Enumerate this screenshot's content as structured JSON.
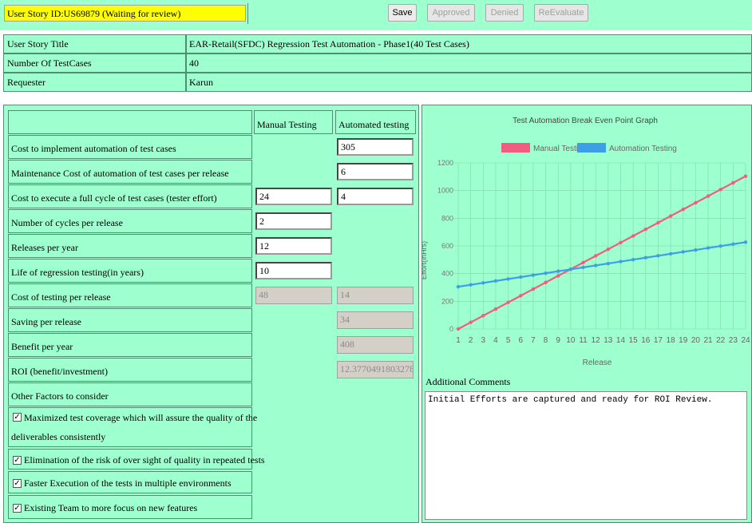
{
  "header": {
    "story_id": "User Story ID:US69879 (Waiting for review)",
    "buttons": {
      "save": "Save",
      "approved": "Approved",
      "denied": "Denied",
      "reevaluate": "ReEvaluate"
    }
  },
  "info": [
    {
      "label": "User Story Title",
      "value": "EAR-Retail(SFDC) Regression Test Automation - Phase1(40 Test Cases)"
    },
    {
      "label": "Number Of TestCases",
      "value": "40"
    },
    {
      "label": "Requester",
      "value": "Karun"
    }
  ],
  "roi_table": {
    "col_manual": "Manual Testing",
    "col_automated": "Automated testing",
    "rows": [
      {
        "label": "Cost to implement automation of test cases",
        "manual": null,
        "automated": "305"
      },
      {
        "label": "Maintenance Cost of automation of test cases per release",
        "manual": null,
        "automated": "6"
      },
      {
        "label": "Cost to execute a full cycle of test cases (tester effort)",
        "manual": "24",
        "automated": "4"
      },
      {
        "label": "Number of cycles per release",
        "manual": "2",
        "automated": null
      },
      {
        "label": "Releases per year",
        "manual": "12",
        "automated": null
      },
      {
        "label": "Life of regression testing(in years)",
        "manual": "10",
        "automated": null
      },
      {
        "label": "Cost of testing per release",
        "manual": "48",
        "automated": "14"
      },
      {
        "label": "Saving per release",
        "manual": null,
        "automated": "34"
      },
      {
        "label": "Benefit per year",
        "manual": null,
        "automated": "408"
      },
      {
        "label": "ROI (benefit/investment)",
        "manual": null,
        "automated": "12.37704918032787"
      }
    ],
    "other_factors_label": "Other Factors to consider",
    "factors": [
      {
        "line1": "Maximized test coverage which will assure the quality of the",
        "line2": "deliverables consistently",
        "checked": true
      },
      {
        "line1": "Elimination of the risk of over sight of quality in repeated tests",
        "checked": true
      },
      {
        "line1": "Faster Execution of the tests in multiple environments",
        "checked": true
      },
      {
        "line1": "Existing Team to more focus on new features",
        "checked": true
      }
    ]
  },
  "chart_data": {
    "type": "line",
    "title": "Test Automation Break Even Point Graph",
    "xlabel": "Release",
    "ylabel": "Effort(inHrs)",
    "x": [
      1,
      2,
      3,
      4,
      5,
      6,
      7,
      8,
      9,
      10,
      11,
      12,
      13,
      14,
      15,
      16,
      17,
      18,
      19,
      20,
      21,
      22,
      23,
      24
    ],
    "ylim": [
      0,
      1200
    ],
    "yticks": [
      0,
      200,
      400,
      600,
      800,
      1000,
      1200
    ],
    "grid": true,
    "legend_position": "top",
    "series": [
      {
        "name": "Manual Testing",
        "color": "#f25c7e",
        "values": [
          0,
          48,
          96,
          144,
          192,
          240,
          288,
          336,
          384,
          432,
          480,
          528,
          576,
          624,
          672,
          720,
          768,
          816,
          864,
          912,
          960,
          1008,
          1056,
          1104
        ]
      },
      {
        "name": "Automation Testing",
        "color": "#3da0e6",
        "values": [
          305,
          319,
          333,
          347,
          361,
          375,
          389,
          403,
          417,
          431,
          445,
          459,
          473,
          487,
          501,
          515,
          529,
          543,
          557,
          571,
          585,
          599,
          613,
          627
        ]
      }
    ]
  },
  "comments": {
    "label": "Additional Comments",
    "text": "Initial Efforts are captured and ready for ROI Review."
  }
}
